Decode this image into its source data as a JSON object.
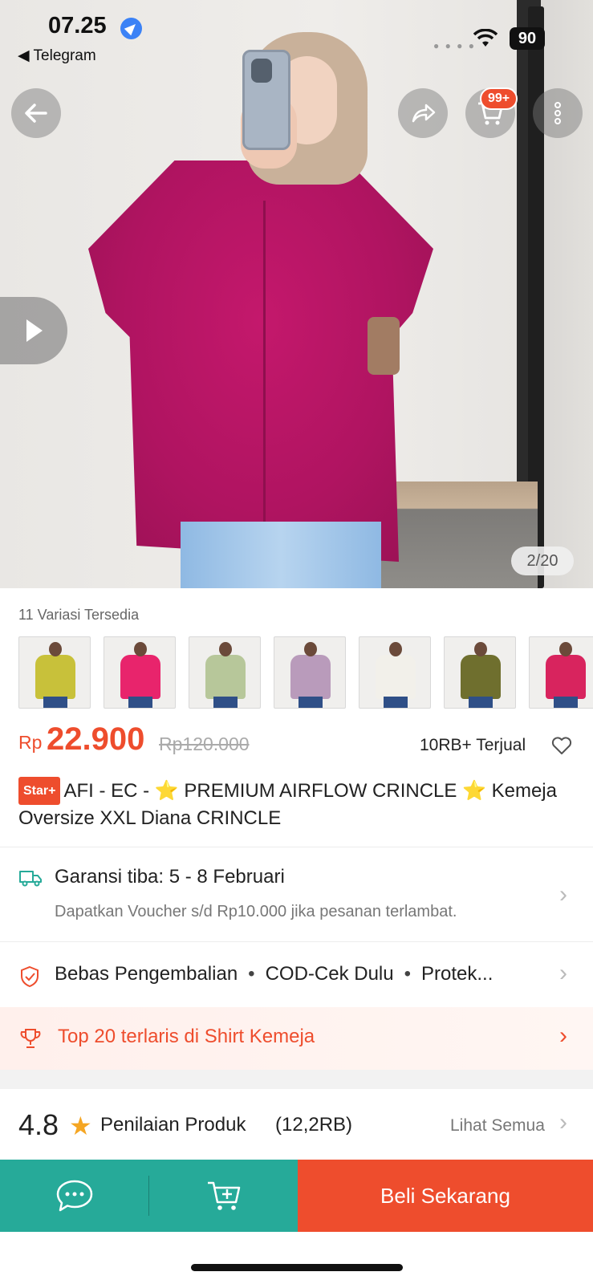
{
  "status_bar": {
    "time": "07.25",
    "back_app": "◀ Telegram",
    "battery": "90"
  },
  "header": {
    "cart_badge": "99+",
    "image_indicator": "2/20"
  },
  "variations": {
    "title": "11 Variasi Tersedia",
    "thumbs": [
      {
        "color": "#c8c13a"
      },
      {
        "color": "#e8246c"
      },
      {
        "color": "#b7c79a"
      },
      {
        "color": "#b99bbb"
      },
      {
        "color": "#f2f0ea"
      },
      {
        "color": "#6f6f2e"
      },
      {
        "color": "#d8245e"
      }
    ]
  },
  "price": {
    "currency": "Rp",
    "current": "22.900",
    "original": "Rp120.000",
    "sold": "10RB+ Terjual"
  },
  "product": {
    "badge": "Star+",
    "title": "AFI - EC - ⭐ PREMIUM AIRFLOW CRINCLE ⭐ Kemeja Oversize XXL Diana CRINCLE"
  },
  "guarantee": {
    "title": "Garansi tiba: 5 - 8 Februari",
    "subtitle": "Dapatkan Voucher s/d Rp10.000 jika pesanan terlambat."
  },
  "services": {
    "item1": "Bebas Pengembalian",
    "item2": "COD-Cek Dulu",
    "item3": "Protek..."
  },
  "ranking": {
    "text": "Top 20 terlaris di Shirt Kemeja"
  },
  "rating": {
    "score": "4.8",
    "label": "Penilaian Produk",
    "count": "(12,2RB)",
    "see_all": "Lihat Semua"
  },
  "bottom_bar": {
    "buy_label": "Beli Sekarang"
  },
  "colors": {
    "accent": "#ee4d2d",
    "bottom_green": "#26aa99"
  }
}
